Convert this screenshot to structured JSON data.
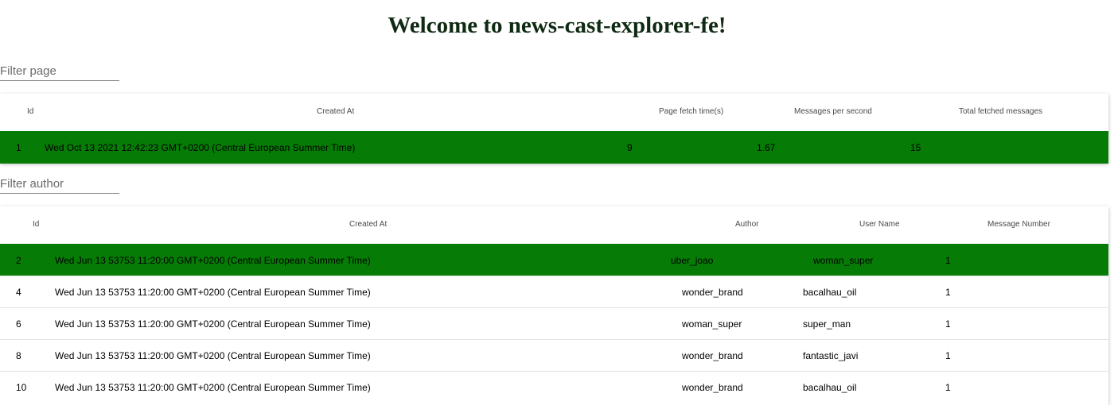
{
  "app": {
    "title": "Welcome to news-cast-explorer-fe!",
    "accent_color": "#067c06"
  },
  "page_filter": {
    "placeholder": "Filter page",
    "value": ""
  },
  "pages_table": {
    "columns": {
      "id": "Id",
      "created_at": "Created At",
      "fetch_time": "Page fetch time(s)",
      "mps": "Messages per second",
      "total": "Total fetched messages"
    },
    "rows": [
      {
        "id": "1",
        "created_at": "Wed Oct 13 2021 12:42:23 GMT+0200 (Central European Summer Time)",
        "fetch_time": "9",
        "mps": "1.67",
        "total": "15",
        "selected": true
      }
    ]
  },
  "author_filter": {
    "placeholder": "Filter author",
    "value": ""
  },
  "messages_table": {
    "columns": {
      "id": "Id",
      "created_at": "Created At",
      "author": "Author",
      "user_name": "User Name",
      "message_number": "Message Number"
    },
    "rows": [
      {
        "id": "2",
        "created_at": "Wed Jun 13 53753 11:20:00 GMT+0200 (Central European Summer Time)",
        "author": "uber_joao",
        "user_name": "woman_super",
        "message_number": "1",
        "selected": true
      },
      {
        "id": "4",
        "created_at": "Wed Jun 13 53753 11:20:00 GMT+0200 (Central European Summer Time)",
        "author": "wonder_brand",
        "user_name": "bacalhau_oil",
        "message_number": "1",
        "selected": false
      },
      {
        "id": "6",
        "created_at": "Wed Jun 13 53753 11:20:00 GMT+0200 (Central European Summer Time)",
        "author": "woman_super",
        "user_name": "super_man",
        "message_number": "1",
        "selected": false
      },
      {
        "id": "8",
        "created_at": "Wed Jun 13 53753 11:20:00 GMT+0200 (Central European Summer Time)",
        "author": "wonder_brand",
        "user_name": "fantastic_javi",
        "message_number": "1",
        "selected": false
      },
      {
        "id": "10",
        "created_at": "Wed Jun 13 53753 11:20:00 GMT+0200 (Central European Summer Time)",
        "author": "wonder_brand",
        "user_name": "bacalhau_oil",
        "message_number": "1",
        "selected": false
      }
    ]
  }
}
